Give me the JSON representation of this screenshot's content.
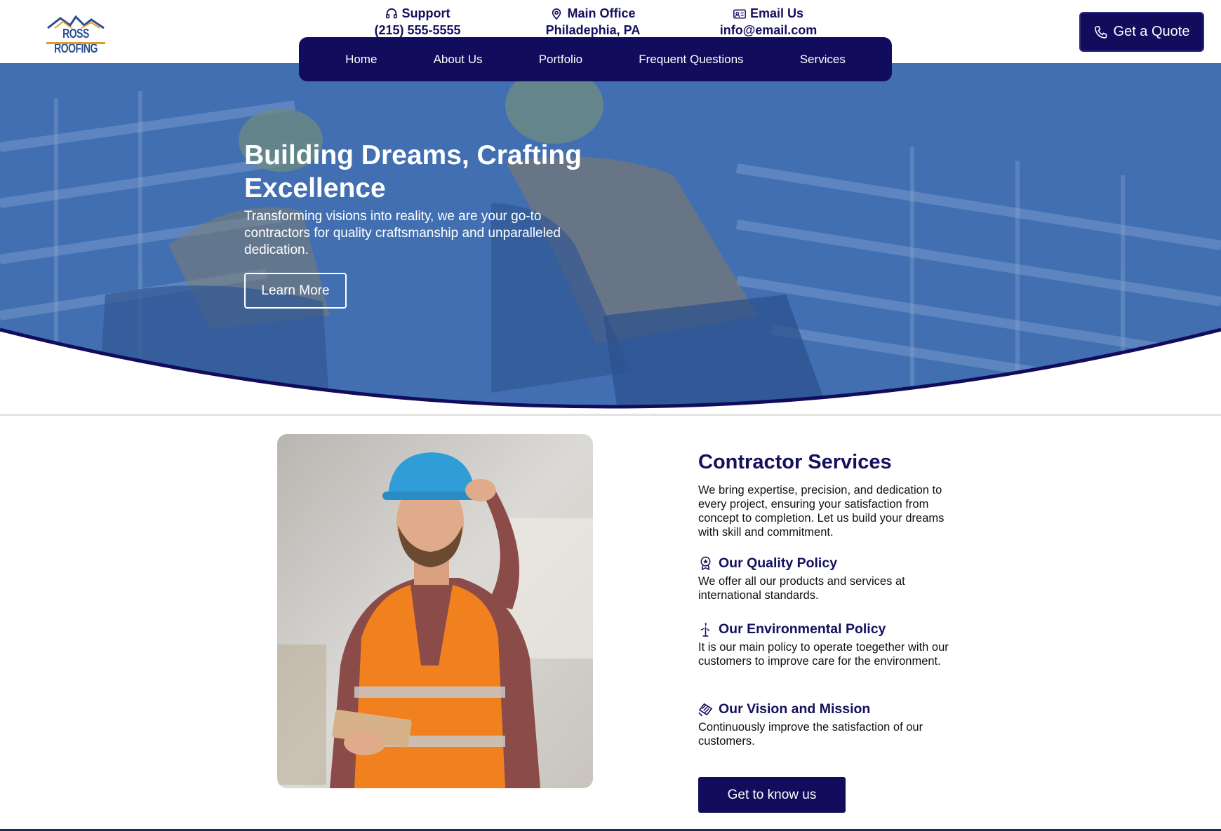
{
  "brand": {
    "logo_text": "ROSS ROOFING"
  },
  "contacts": {
    "support": {
      "label": "Support",
      "value": "(215) 555-5555",
      "icon": "headset-icon"
    },
    "office": {
      "label": "Main Office",
      "value": "Philadephia, PA",
      "icon": "map-pin-icon"
    },
    "email": {
      "label": "Email Us",
      "value": "info@email.com",
      "icon": "contact-card-icon"
    }
  },
  "quote_button": {
    "label": "Get a Quote",
    "icon": "phone-icon"
  },
  "nav": {
    "items": [
      "Home",
      "About Us",
      "Portfolio",
      "Frequent Questions",
      "Services"
    ]
  },
  "hero": {
    "title": "Building Dreams, Crafting Excellence",
    "subtitle": "Transforming visions into reality, we are your go-to contractors for quality craftsmanship and unparalleled dedication.",
    "button": "Learn More"
  },
  "services": {
    "title": "Contractor Services",
    "description": "We bring expertise, precision, and dedication to every project, ensuring your satisfaction from concept to completion. Let us build your dreams with skill and commitment.",
    "policies": [
      {
        "title": "Our Quality Policy",
        "text": "We offer all our products and services at international standards.",
        "icon": "award-badge-icon"
      },
      {
        "title": "Our Environmental Policy",
        "text": "It is our main policy to operate toegether with our customers to improve care for the environment.",
        "icon": "wind-turbine-icon"
      },
      {
        "title": "Our Vision and Mission",
        "text": "Continuously improve the satisfaction of our customers.",
        "icon": "handshake-icon"
      }
    ],
    "button": "Get to know us"
  },
  "colors": {
    "navy": "#110c5c",
    "heading": "#14105e",
    "hero_overlay": "#3a66ad",
    "accent_orange": "#f0811e"
  }
}
